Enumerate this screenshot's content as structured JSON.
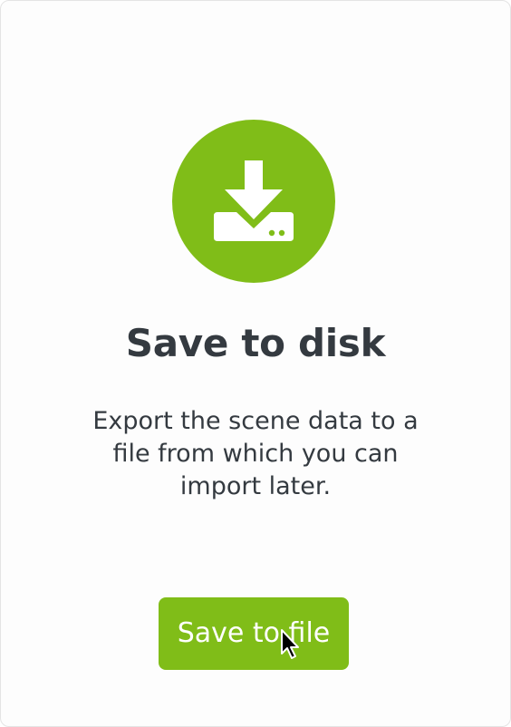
{
  "dialog": {
    "icon": "save-to-disk-icon",
    "title": "Save to disk",
    "description": "Export the scene data to a file from which you can import later.",
    "button_label": "Save to file"
  },
  "colors": {
    "accent": "#80bd18",
    "text": "#343a40",
    "background": "#fdfdfd"
  }
}
